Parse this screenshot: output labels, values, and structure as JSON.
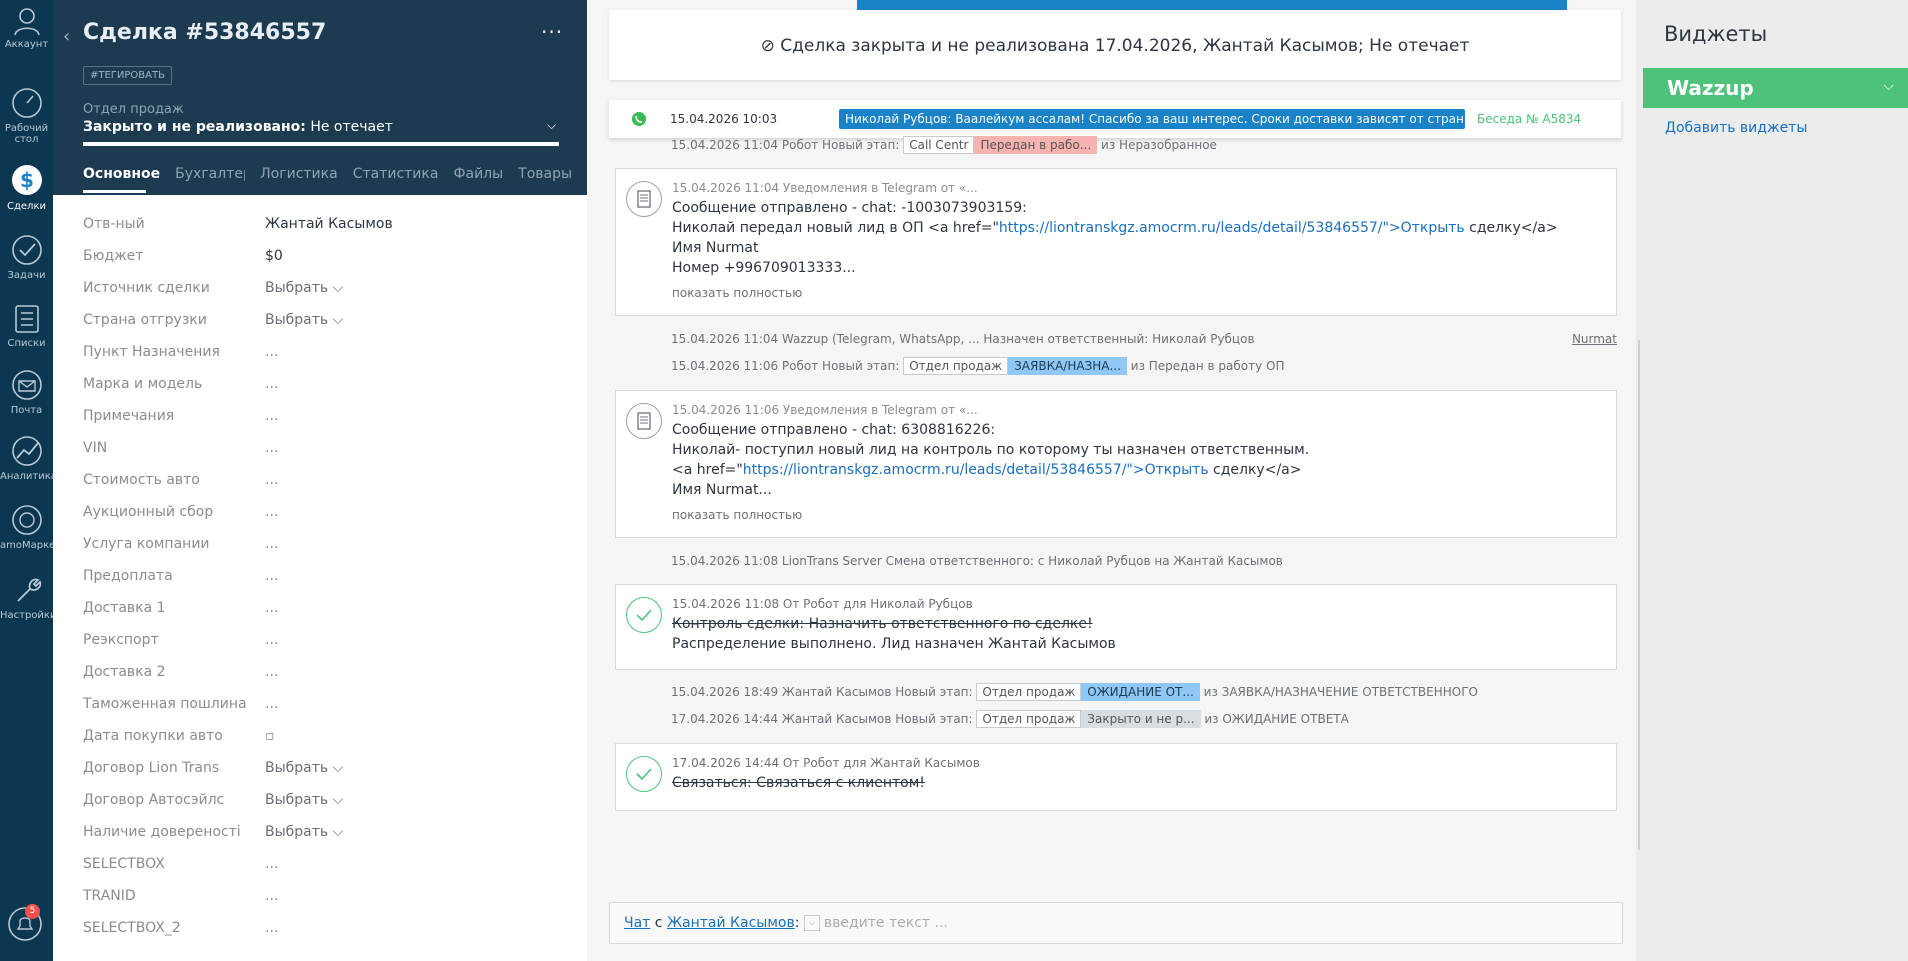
{
  "nav": {
    "items": [
      {
        "label": "Аккаунт"
      },
      {
        "label": "Рабочий стол"
      },
      {
        "label": "Сделки"
      },
      {
        "label": "Задачи"
      },
      {
        "label": "Списки"
      },
      {
        "label": "Почта"
      },
      {
        "label": "Аналитика"
      },
      {
        "label": "amoМаркет"
      },
      {
        "label": "Настройки"
      }
    ],
    "notifications_count": "5"
  },
  "deal": {
    "title": "Сделка #53846557",
    "menu": "···",
    "tag_button": "#ТЕГИРОВАТЬ",
    "pipeline": "Отдел продаж",
    "status_prefix": "Закрыто и не реализовано:",
    "status_reason": " Не отечает",
    "tabs": [
      "Основное",
      "Бухгалтерия",
      "Логистика",
      "Статистика",
      "Файлы",
      "Товары",
      "···"
    ],
    "fields": [
      {
        "label": "Отв-ный",
        "value": "Жантай Касымов"
      },
      {
        "label": "Бюджет",
        "value": "$0"
      },
      {
        "label": "Источник сделки",
        "value": "Выбрать ⌵"
      },
      {
        "label": "Страна отгрузки",
        "value": "Выбрать ⌵"
      },
      {
        "label": "Пункт Назначения",
        "value": "..."
      },
      {
        "label": "Марка и модель",
        "value": "..."
      },
      {
        "label": "Примечания",
        "value": "..."
      },
      {
        "label": "VIN",
        "value": "..."
      },
      {
        "label": "Стоимость авто",
        "value": "..."
      },
      {
        "label": "Аукционный сбор",
        "value": "..."
      },
      {
        "label": "Услуга компании",
        "value": "..."
      },
      {
        "label": "Предоплата",
        "value": "..."
      },
      {
        "label": "Доставка 1",
        "value": "..."
      },
      {
        "label": "Реэкспорт",
        "value": "..."
      },
      {
        "label": "Доставка 2",
        "value": "..."
      },
      {
        "label": "Таможенная пошлина",
        "value": "..."
      },
      {
        "label": "Дата покупки авто",
        "value": "▫"
      },
      {
        "label": "Договор Lion Trans",
        "value": "Выбрать ⌵"
      },
      {
        "label": "Договор Автосэйлс",
        "value": "Выбрать ⌵"
      },
      {
        "label": "Наличие довереності",
        "value": "Выбрать ⌵"
      },
      {
        "label": "SELECTBOX",
        "value": "..."
      },
      {
        "label": "TRANID",
        "value": "..."
      },
      {
        "label": "SELECTBOX_2",
        "value": "..."
      }
    ]
  },
  "feed": {
    "closed_banner": "⊘ Сделка закрыта и не реализована 17.04.2026, Жантай Касымов; Не отечает",
    "whatsapp": {
      "time": "15.04.2026 10:03",
      "message": "Николай Рубцов: Ваалейкум ассалам! Спасибо за ваш интерес. Сроки доставки зависят от страны отправк...",
      "link": "Беседа № A5834"
    },
    "sys1": {
      "text": "15.04.2026 11:04 Робот Новый этап:",
      "chip1": "Call Centr",
      "chip2": "Передан в рабо...",
      "tail": "из Неразобранное"
    },
    "note1": {
      "meta": "15.04.2026 11:04 Уведомления в Telegram от «...",
      "line1": "Сообщение отправлено - chat: -1003073903159:",
      "line2_pre": "Николай передал новый лид в ОП <a href=\"",
      "line2_link": "https://liontranskgz.amocrm.ru/leads/detail/53846557/\">Открыть",
      "line2_post": " сделку</a>",
      "line3": "Имя Nurmat",
      "line4": "Номер +996709013333...",
      "more": "показать полностью"
    },
    "sys2": {
      "text": "15.04.2026 11:04 Wazzup (Telegram, WhatsApp, ... Назначен ответственный: Николай Рубцов",
      "link": "Nurmat"
    },
    "sys3": {
      "text": "15.04.2026 11:06 Робот Новый этап:",
      "chip1": "Отдел продаж",
      "chip2": "ЗАЯВКА/НАЗНА...",
      "tail": "из Передан в работу ОП"
    },
    "note2": {
      "meta": "15.04.2026 11:06 Уведомления в Telegram от «...",
      "line1": "Сообщение отправлено - chat: 6308816226:",
      "line2": "Николай- поступил новый лид на контроль по которому ты назначен ответственным.",
      "line3_pre": "<a href=\"",
      "line3_link": "https://liontranskgz.amocrm.ru/leads/detail/53846557/\">Открыть",
      "line3_post": " сделку</a>",
      "line4": "Имя Nurmat...",
      "more": "показать полностью"
    },
    "sys4": {
      "text": "15.04.2026 11:08 LionTrans Server Смена ответственного: с Николай Рубцов на Жантай Касымов"
    },
    "task1": {
      "meta": "15.04.2026 11:08  От Робот для Николай Рубцов",
      "line1": "Контроль сделки: Назначить ответственного по сделке!",
      "line2": "Распределение выполнено. Лид назначен Жантай Касымов"
    },
    "sys5": {
      "text": "15.04.2026 18:49 Жантай Касымов Новый этап:",
      "chip1": "Отдел продаж",
      "chip2": "ОЖИДАНИЕ ОТ...",
      "tail": "из ЗАЯВКА/НАЗНАЧЕНИЕ ОТВЕТСТВЕННОГО"
    },
    "sys6": {
      "text": "17.04.2026 14:44 Жантай Касымов Новый этап:",
      "chip1": "Отдел продаж",
      "chip2": "Закрыто и не р...",
      "tail": "из ОЖИДАНИЕ ОТВЕТА"
    },
    "task2": {
      "meta": "17.04.2026 14:44  От Робот для Жантай Касымов",
      "line1": "Связаться: Связаться с клиентом!"
    },
    "chat": {
      "prefix": "Чат",
      "with": " с ",
      "user": "Жантай Касымов",
      "colon": ":",
      "placeholder": "введите текст ..."
    }
  },
  "widgets": {
    "title": "Виджеты",
    "wazzup": "Wazzup",
    "add": "Добавить виджеты"
  },
  "colors": {
    "nav": "#0c3750",
    "deal_header": "#1d3b50",
    "accent_blue": "#1a82c6",
    "wazzup_green": "#4ec27a"
  }
}
